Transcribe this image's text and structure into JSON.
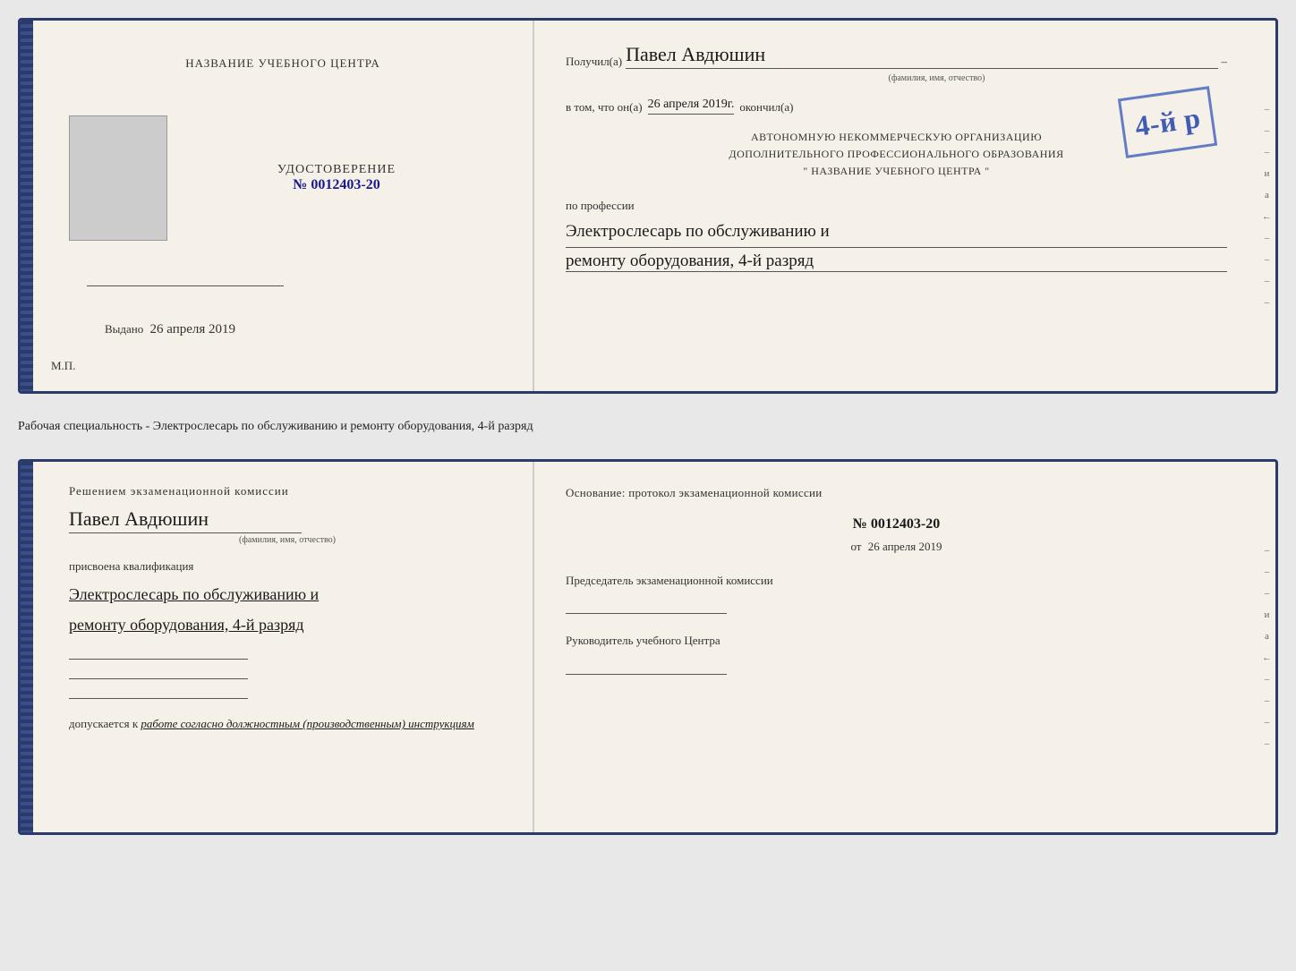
{
  "top_document": {
    "left": {
      "training_center_label": "НАЗВАНИЕ УЧЕБНОГО ЦЕНТРА",
      "udostoverenie_label": "УДОСТОВЕРЕНИЕ",
      "number_label": "№ 0012403-20",
      "vydano_label": "Выдано",
      "vydano_date": "26 апреля 2019",
      "mp_label": "М.П."
    },
    "right": {
      "poluchil_label": "Получил(а)",
      "recipient_name": "Павел Авдюшин",
      "fio_label": "(фамилия, имя, отчество)",
      "dash": "–",
      "vtom_label": "в том, что он(а)",
      "date_value": "26 апреля 2019г.",
      "okonchil_label": "окончил(а)",
      "stamp_number": "4-й р",
      "stamp_line1": "АВТОНОМНУЮ НЕКОММЕРЧЕСКУЮ ОРГАНИЗАЦИЮ",
      "stamp_line2": "ДОПОЛНИТЕЛЬНОГО ПРОФЕССИОНАЛЬНОГО ОБРАЗОВАНИЯ",
      "stamp_line3": "\" НАЗВАНИЕ УЧЕБНОГО ЦЕНТРА \"",
      "po_professii_label": "по профессии",
      "profession_line1": "Электрослесарь по обслуживанию и",
      "profession_line2": "ремонту оборудования, 4-й разряд"
    }
  },
  "middle": {
    "text": "Рабочая специальность - Электрослесарь по обслуживанию и ремонту оборудования, 4-й разряд"
  },
  "bottom_document": {
    "left": {
      "reshenie_label": "Решением экзаменационной комиссии",
      "person_name": "Павел Авдюшин",
      "fio_label": "(фамилия, имя, отчество)",
      "prisvoena_label": "присвоена квалификация",
      "qualification_line1": "Электрослесарь по обслуживанию и",
      "qualification_line2": "ремонту оборудования, 4-й разряд",
      "dopuskaetsya_label": "допускается к",
      "dopuskaetsya_value": "работе согласно должностным (производственным) инструкциям"
    },
    "right": {
      "osnovanie_label": "Основание: протокол экзаменационной комиссии",
      "protokol_number": "№ 0012403-20",
      "ot_label": "от",
      "ot_date": "26 апреля 2019",
      "predsedatel_label": "Председатель экзаменационной комиссии",
      "rukovoditel_label": "Руководитель учебного Центра"
    }
  },
  "side_marks": {
    "right_marks": [
      "–",
      "–",
      "–",
      "и",
      "а",
      "←",
      "–",
      "–",
      "–",
      "–"
    ]
  }
}
